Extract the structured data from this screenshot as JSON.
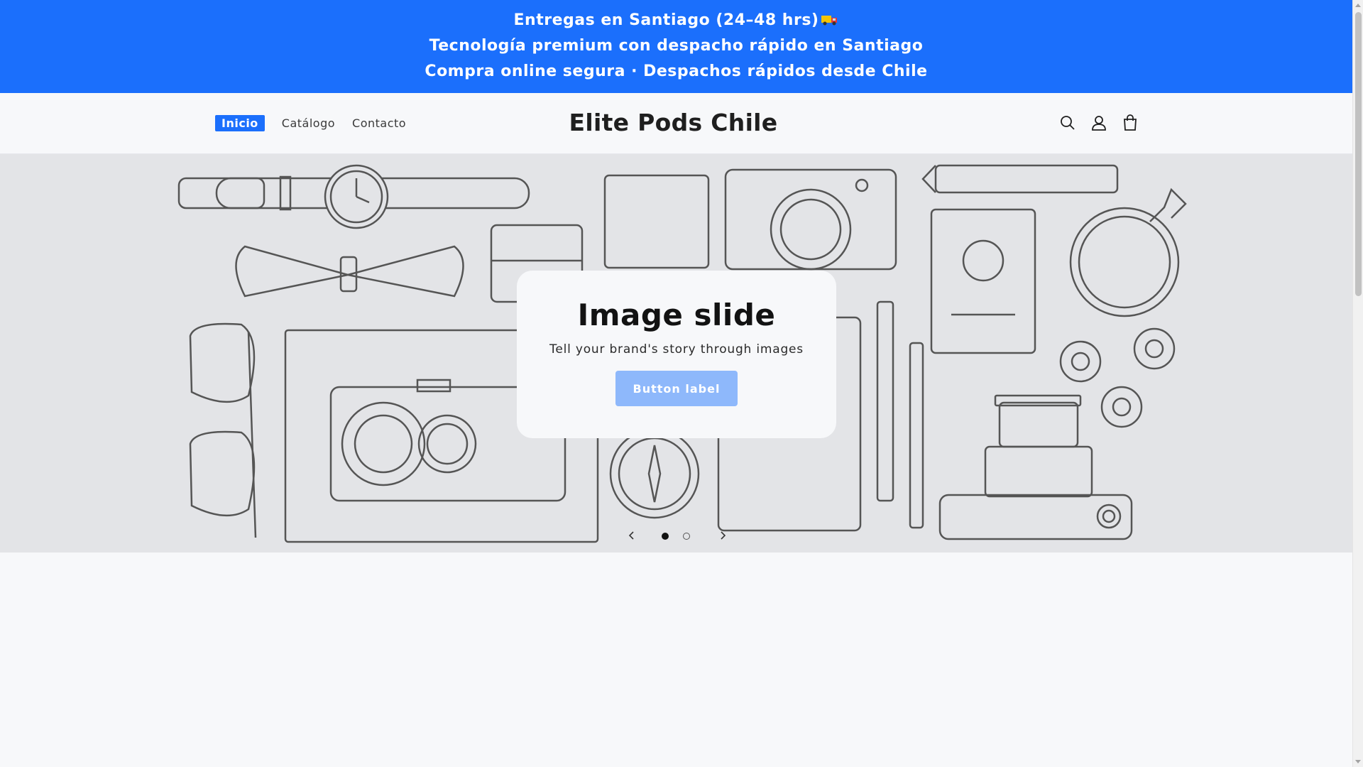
{
  "announcement": {
    "lines": [
      "Entregas en Santiago (24–48 hrs)",
      "Tecnología premium con despacho rápido en Santiago",
      "Compra online segura · Despachos rápidos desde Chile"
    ],
    "icon": "truck-icon"
  },
  "header": {
    "nav": [
      {
        "label": "Inicio",
        "active": true
      },
      {
        "label": "Catálogo",
        "active": false
      },
      {
        "label": "Contacto",
        "active": false
      }
    ],
    "brand": "Elite Pods Chile",
    "icons": [
      "search-icon",
      "account-icon",
      "cart-icon"
    ]
  },
  "hero": {
    "title": "Image slide",
    "subtitle": "Tell your brand's story through images",
    "button_label": "Button label",
    "slides": {
      "current": 1,
      "total": 2
    }
  },
  "colors": {
    "accent": "#1b6ffc",
    "button": "#8eb8fb",
    "hero_bg": "#e3e4e7",
    "page_bg": "#f7f8fa"
  }
}
